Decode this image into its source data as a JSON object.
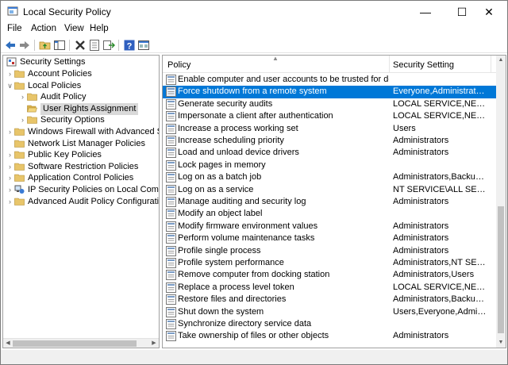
{
  "window": {
    "title": "Local Security Policy",
    "controls": {
      "minimize": "—",
      "maximize": "☐",
      "close": "✕"
    }
  },
  "menu": [
    "File",
    "Action",
    "View",
    "Help"
  ],
  "toolbar": [
    "back-arrow-icon",
    "forward-arrow-icon",
    "up-folder-icon",
    "show-hide-tree-icon",
    "delete-icon",
    "properties-icon",
    "export-list-icon",
    "help-icon",
    "console-icon"
  ],
  "tree": {
    "root": "Security Settings",
    "items": [
      {
        "label": "Account Policies"
      },
      {
        "label": "Local Policies"
      },
      {
        "label": "Audit Policy"
      },
      {
        "label": "User Rights Assignment"
      },
      {
        "label": "Security Options"
      },
      {
        "label": "Windows Firewall with Advanced Secu"
      },
      {
        "label": "Network List Manager Policies"
      },
      {
        "label": "Public Key Policies"
      },
      {
        "label": "Software Restriction Policies"
      },
      {
        "label": "Application Control Policies"
      },
      {
        "label": "IP Security Policies on Local Compute"
      },
      {
        "label": "Advanced Audit Policy Configuration"
      }
    ]
  },
  "list": {
    "columns": {
      "policy": "Policy",
      "setting": "Security Setting"
    },
    "rows": [
      {
        "policy": "Enable computer and user accounts to be trusted for delega...",
        "setting": ""
      },
      {
        "policy": "Force shutdown from a remote system",
        "setting": "Everyone,Administrators"
      },
      {
        "policy": "Generate security audits",
        "setting": "LOCAL SERVICE,NETWO..."
      },
      {
        "policy": "Impersonate a client after authentication",
        "setting": "LOCAL SERVICE,NETWO..."
      },
      {
        "policy": "Increase a process working set",
        "setting": "Users"
      },
      {
        "policy": "Increase scheduling priority",
        "setting": "Administrators"
      },
      {
        "policy": "Load and unload device drivers",
        "setting": "Administrators"
      },
      {
        "policy": "Lock pages in memory",
        "setting": ""
      },
      {
        "policy": "Log on as a batch job",
        "setting": "Administrators,Backup ..."
      },
      {
        "policy": "Log on as a service",
        "setting": "NT SERVICE\\ALL SERVIC..."
      },
      {
        "policy": "Manage auditing and security log",
        "setting": "Administrators"
      },
      {
        "policy": "Modify an object label",
        "setting": ""
      },
      {
        "policy": "Modify firmware environment values",
        "setting": "Administrators"
      },
      {
        "policy": "Perform volume maintenance tasks",
        "setting": "Administrators"
      },
      {
        "policy": "Profile single process",
        "setting": "Administrators"
      },
      {
        "policy": "Profile system performance",
        "setting": "Administrators,NT SERVI..."
      },
      {
        "policy": "Remove computer from docking station",
        "setting": "Administrators,Users"
      },
      {
        "policy": "Replace a process level token",
        "setting": "LOCAL SERVICE,NETWO..."
      },
      {
        "policy": "Restore files and directories",
        "setting": "Administrators,Backup ..."
      },
      {
        "policy": "Shut down the system",
        "setting": "Users,Everyone,Administ..."
      },
      {
        "policy": "Synchronize directory service data",
        "setting": ""
      },
      {
        "policy": "Take ownership of files or other objects",
        "setting": "Administrators"
      }
    ]
  },
  "colors": {
    "selection": "#0078d7",
    "tree_selection": "#d9d9d9",
    "folder": "#e8c56a"
  }
}
